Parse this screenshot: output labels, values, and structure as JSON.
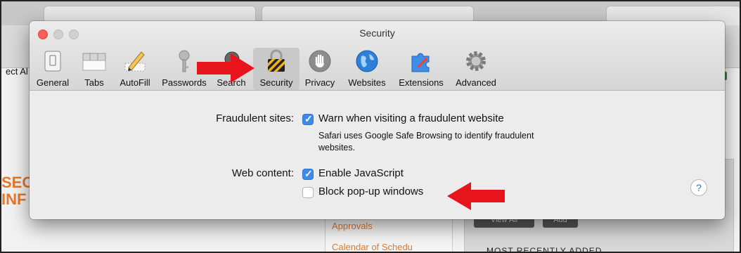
{
  "background": {
    "select_text": "ect Al",
    "section_text_1": "SEC",
    "section_text_2": "INF",
    "links": [
      "Approvals",
      "Calendar of Schedu"
    ],
    "buttons": [
      "View All",
      "Add"
    ],
    "recent_heading": "MOST RECENTLY ADDED"
  },
  "window": {
    "title": "Security",
    "toolbar": [
      {
        "label": "General",
        "icon": "general-icon"
      },
      {
        "label": "Tabs",
        "icon": "tabs-icon"
      },
      {
        "label": "AutoFill",
        "icon": "autofill-pencil-icon"
      },
      {
        "label": "Passwords",
        "icon": "key-icon"
      },
      {
        "label": "Search",
        "icon": "magnifier-icon"
      },
      {
        "label": "Security",
        "icon": "lock-icon",
        "selected": true
      },
      {
        "label": "Privacy",
        "icon": "hand-icon"
      },
      {
        "label": "Websites",
        "icon": "globe-icon"
      },
      {
        "label": "Extensions",
        "icon": "puzzle-icon"
      },
      {
        "label": "Advanced",
        "icon": "gear-icon"
      }
    ],
    "fraudulent": {
      "label": "Fraudulent sites:",
      "option": "Warn when visiting a fraudulent website",
      "checked": true,
      "note": "Safari uses Google Safe Browsing to identify fraudulent websites."
    },
    "web_content": {
      "label": "Web content:",
      "options": [
        {
          "label": "Enable JavaScript",
          "checked": true
        },
        {
          "label": "Block pop-up windows",
          "checked": false
        }
      ]
    },
    "help": "?"
  },
  "colors": {
    "arrow": "#e8141b",
    "accent": "#3d8ae8",
    "link": "#e07a2c"
  }
}
